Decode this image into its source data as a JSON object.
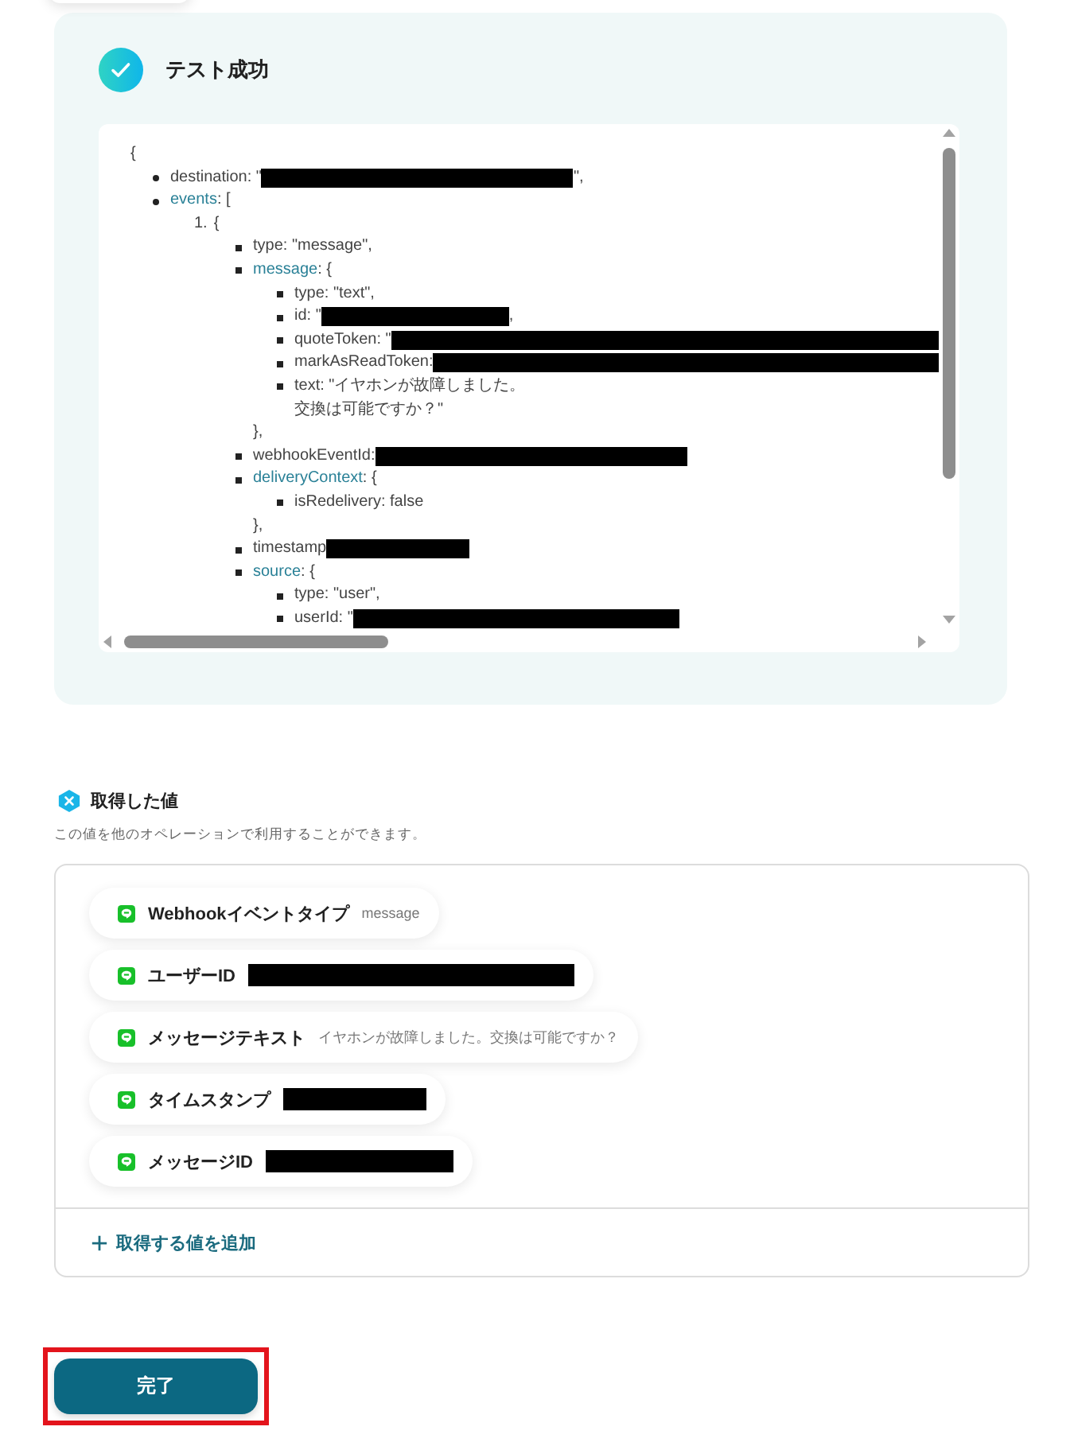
{
  "test_result": {
    "title": "テスト成功",
    "success": true,
    "code": {
      "open": "{",
      "items": [
        {
          "key": "destination",
          "expandable": false,
          "text": ": \"",
          "redaction": {
            "kind": "long"
          },
          "tail": "\","
        },
        {
          "key": "events",
          "expandable": true,
          "text": ": [",
          "children": [
            {
              "marker": "1.",
              "text": "{",
              "children": [
                {
                  "key": "type",
                  "expandable": false,
                  "text": ": \"message\","
                },
                {
                  "key": "message",
                  "expandable": true,
                  "text": ": {",
                  "children": [
                    {
                      "key": "type",
                      "expandable": false,
                      "text": ": \"text\","
                    },
                    {
                      "key": "id",
                      "expandable": false,
                      "text": ": \"",
                      "redaction": {
                        "kind": "medium"
                      },
                      "tail": ","
                    },
                    {
                      "key": "quoteToken",
                      "expandable": false,
                      "text": ": \"",
                      "redaction": {
                        "kind": "full"
                      }
                    },
                    {
                      "key": "markAsReadToken",
                      "expandable": false,
                      "text": ": ",
                      "redaction": {
                        "kind": "full"
                      }
                    },
                    {
                      "key": "text",
                      "expandable": false,
                      "text": ": \"イヤホンが故障しました。",
                      "continuation": "交換は可能ですか？\""
                    }
                  ],
                  "close": "},"
                },
                {
                  "key": "webhookEventId",
                  "expandable": false,
                  "text": ": ",
                  "redaction": {
                    "kind": "long"
                  }
                },
                {
                  "key": "deliveryContext",
                  "expandable": true,
                  "text": ": {",
                  "children": [
                    {
                      "key": "isRedelivery",
                      "expandable": false,
                      "text": ": false"
                    }
                  ],
                  "close": "},"
                },
                {
                  "key": "timestamp",
                  "expandable": false,
                  "redaction": {
                    "kind": "short"
                  }
                },
                {
                  "key": "source",
                  "expandable": true,
                  "text": ": {",
                  "children": [
                    {
                      "key": "type",
                      "expandable": false,
                      "text": ": \"user\","
                    },
                    {
                      "key": "userId",
                      "expandable": false,
                      "text": ": \"",
                      "redaction": {
                        "kind": "xlong"
                      }
                    }
                  ]
                }
              ]
            }
          ]
        }
      ]
    }
  },
  "values": {
    "title": "取得した値",
    "description": "この値を他のオペレーションで利用することができます。",
    "items": [
      {
        "label": "Webhookイベントタイプ",
        "value": "message"
      },
      {
        "label": "ユーザーID",
        "redaction": {
          "kind": "xlong"
        }
      },
      {
        "label": "メッセージテキスト",
        "value": "イヤホンが故障しました。交換は可能ですか？"
      },
      {
        "label": "タイムスタンプ",
        "redaction": {
          "kind": "short"
        }
      },
      {
        "label": "メッセージID",
        "redaction": {
          "kind": "medium"
        }
      }
    ],
    "add_label": "取得する値を追加"
  },
  "done_button": {
    "label": "完了",
    "highlighted": true
  }
}
